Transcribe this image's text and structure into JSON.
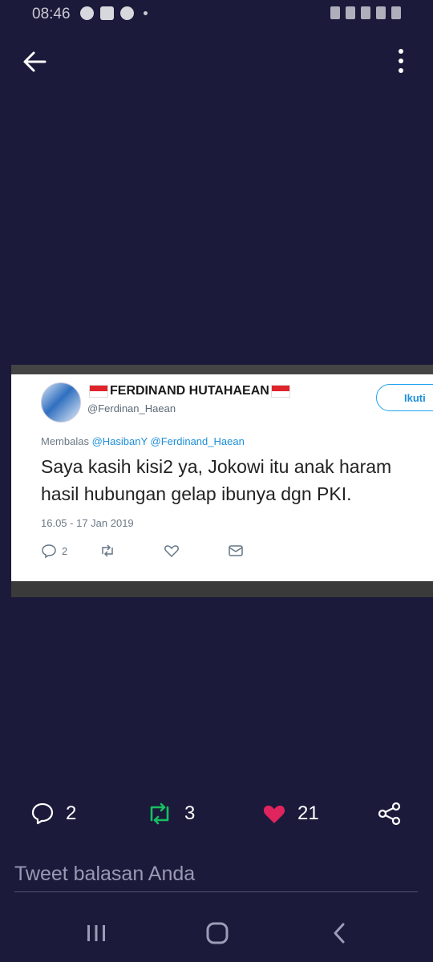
{
  "status_bar": {
    "time": "08:46"
  },
  "header": {
    "back_icon": "arrow-left-icon",
    "more_icon": "vertical-dots-icon"
  },
  "tweet_image": {
    "display_name": "FERDINAND HUTAHAEAN",
    "handle": "@Ferdinan_Haean",
    "follow_label": "Ikuti",
    "reply_prefix": "Membalas",
    "reply_mentions": "@HasibanY @Ferdinand_Haean",
    "text_line1": "Saya kasih kisi2 ya, Jokowi itu anak haram",
    "text_line2": "hasil hubungan gelap ibunya dgn PKI.",
    "date": "16.05 - 17 Jan 2019",
    "reply_count": "2"
  },
  "actions": {
    "reply_count": "2",
    "retweet_count": "3",
    "like_count": "21",
    "like_color": "#e0245e",
    "retweet_color": "#17bf63"
  },
  "reply_box": {
    "placeholder": "Tweet balasan Anda"
  },
  "nav": {
    "recents_icon": "recents-icon",
    "home_icon": "home-icon",
    "back_icon": "back-chevron-icon"
  }
}
